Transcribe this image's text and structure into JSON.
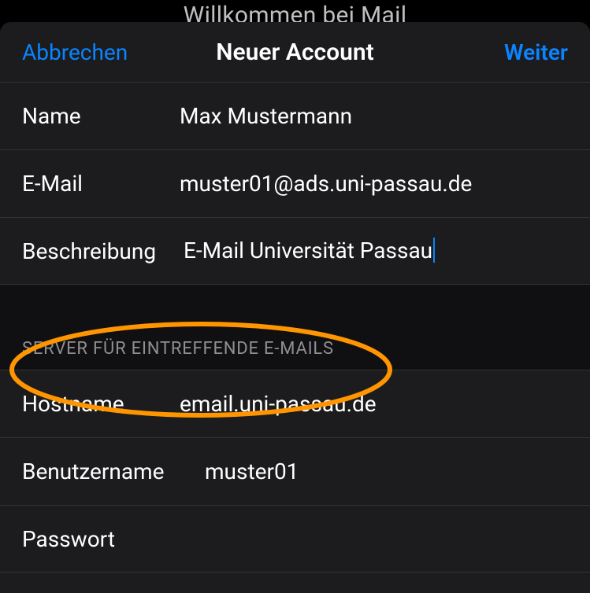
{
  "backdrop": {
    "title": "Willkommen bei Mail"
  },
  "navbar": {
    "cancel": "Abbrechen",
    "title": "Neuer Account",
    "next": "Weiter"
  },
  "account": {
    "name_label": "Name",
    "name_value": "Max Mustermann",
    "email_label": "E-Mail",
    "email_value": "muster01@ads.uni-passau.de",
    "desc_label": "Beschreibung",
    "desc_value": "E-Mail Universität Passau"
  },
  "incoming": {
    "header": "SERVER FÜR EINTREFFENDE E-MAILS",
    "host_label": "Hostname",
    "host_value": "email.uni-passau.de",
    "user_label": "Benutzername",
    "user_value": "muster01",
    "pass_label": "Passwort",
    "pass_value": ""
  },
  "annotation": {
    "color": "#ff9500"
  }
}
